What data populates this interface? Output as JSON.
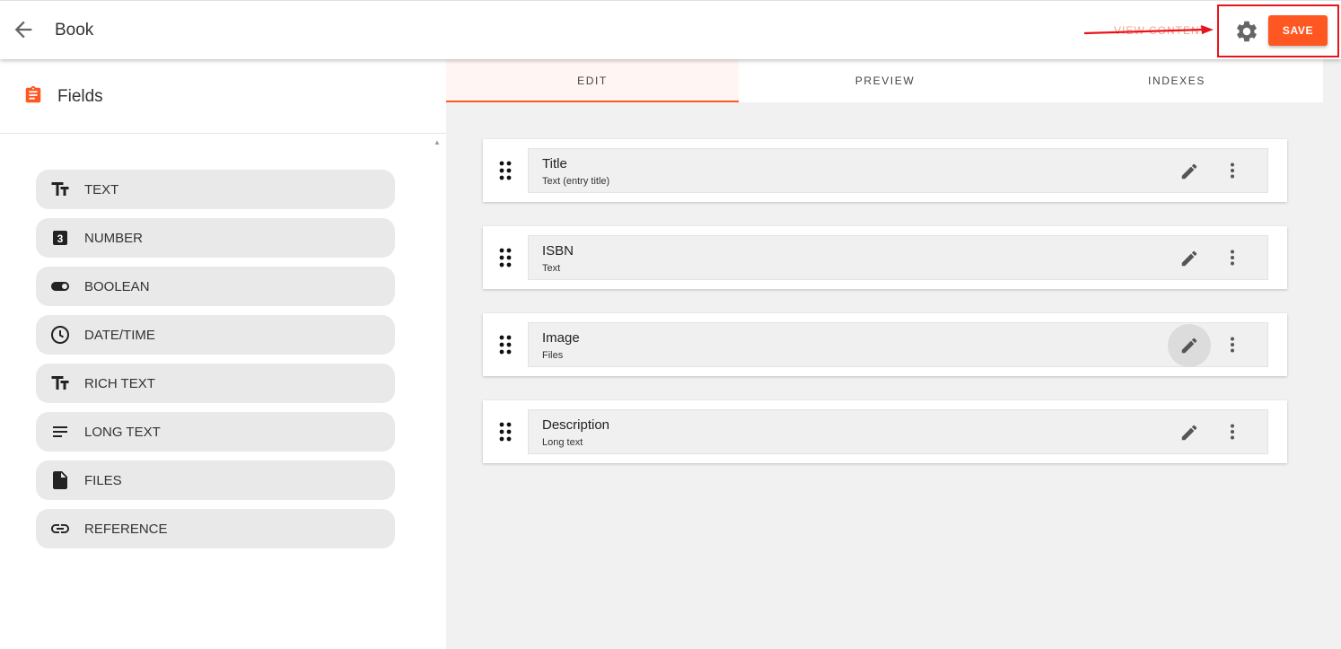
{
  "header": {
    "back_icon": "arrow-left-icon",
    "title": "Book",
    "view_content_label": "VIEW CONTENT",
    "settings_icon": "gear-icon",
    "save_label": "SAVE",
    "accent_color": "#ff5722",
    "annotation_color": "#e8141c"
  },
  "sidebar": {
    "title": "Fields",
    "title_icon": "clipboard-icon",
    "field_types": [
      {
        "label": "TEXT",
        "icon": "text-format-icon"
      },
      {
        "label": "NUMBER",
        "icon": "number-box-icon"
      },
      {
        "label": "BOOLEAN",
        "icon": "toggle-icon"
      },
      {
        "label": "DATE/TIME",
        "icon": "clock-icon"
      },
      {
        "label": "RICH TEXT",
        "icon": "text-format-icon"
      },
      {
        "label": "LONG TEXT",
        "icon": "lines-icon"
      },
      {
        "label": "FILES",
        "icon": "file-icon"
      },
      {
        "label": "REFERENCE",
        "icon": "link-icon"
      }
    ]
  },
  "tabs": [
    {
      "label": "EDIT",
      "active": true
    },
    {
      "label": "PREVIEW",
      "active": false
    },
    {
      "label": "INDEXES",
      "active": false
    }
  ],
  "fields": [
    {
      "name": "Title",
      "type": "Text (entry title)"
    },
    {
      "name": "ISBN",
      "type": "Text"
    },
    {
      "name": "Image",
      "type": "Files"
    },
    {
      "name": "Description",
      "type": "Long text"
    }
  ]
}
